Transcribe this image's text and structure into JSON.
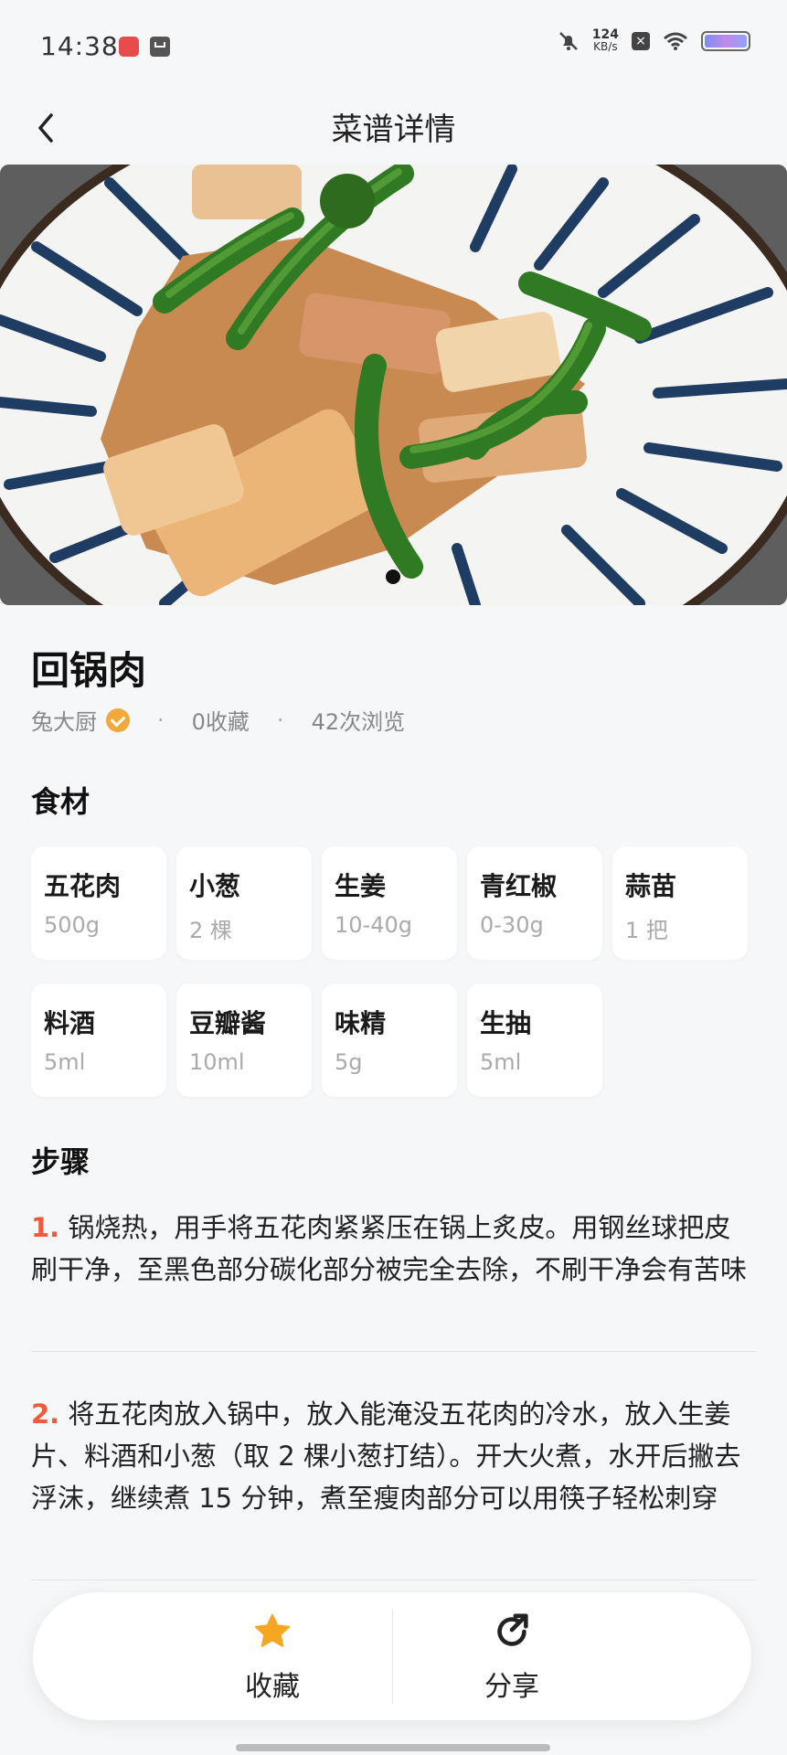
{
  "status_bar": {
    "time": "14:38",
    "speed_value": "124",
    "speed_unit": "KB/s"
  },
  "header": {
    "title": "菜谱详情"
  },
  "recipe": {
    "name": "回锅肉",
    "author": "兔大厨",
    "favorites": "0收藏",
    "views": "42次浏览",
    "sep": "·"
  },
  "sections": {
    "ingredients_title": "食材",
    "steps_title": "步骤"
  },
  "ingredients": [
    {
      "name": "五花肉",
      "amount": "500g"
    },
    {
      "name": "小葱",
      "amount": "2 棵"
    },
    {
      "name": "生姜",
      "amount": "10-40g"
    },
    {
      "name": "青红椒",
      "amount": "0-30g"
    },
    {
      "name": "蒜苗",
      "amount": "1 把"
    },
    {
      "name": "料酒",
      "amount": "5ml"
    },
    {
      "name": "豆瓣酱",
      "amount": "10ml"
    },
    {
      "name": "味精",
      "amount": "5g"
    },
    {
      "name": "生抽",
      "amount": "5ml"
    }
  ],
  "steps": [
    {
      "num": "1.",
      "text": "锅烧热，用手将五花肉紧紧压在锅上炙皮。用钢丝球把皮刷干净，至黑色部分碳化部分被完全去除，不刷干净会有苦味"
    },
    {
      "num": "2.",
      "text": "将五花肉放入锅中，放入能淹没五花肉的冷水，放入生姜片、料酒和小葱（取 2 棵小葱打结）。开大火煮，水开后撇去浮沫，继续煮 15 分钟，煮至瘦肉部分可以用筷子轻松刺穿"
    }
  ],
  "bottom_bar": {
    "favorite_label": "收藏",
    "share_label": "分享"
  },
  "colors": {
    "accent_orange": "#f2a83a",
    "step_number": "#ee5a3a",
    "plate_blue": "#1f3d63"
  }
}
